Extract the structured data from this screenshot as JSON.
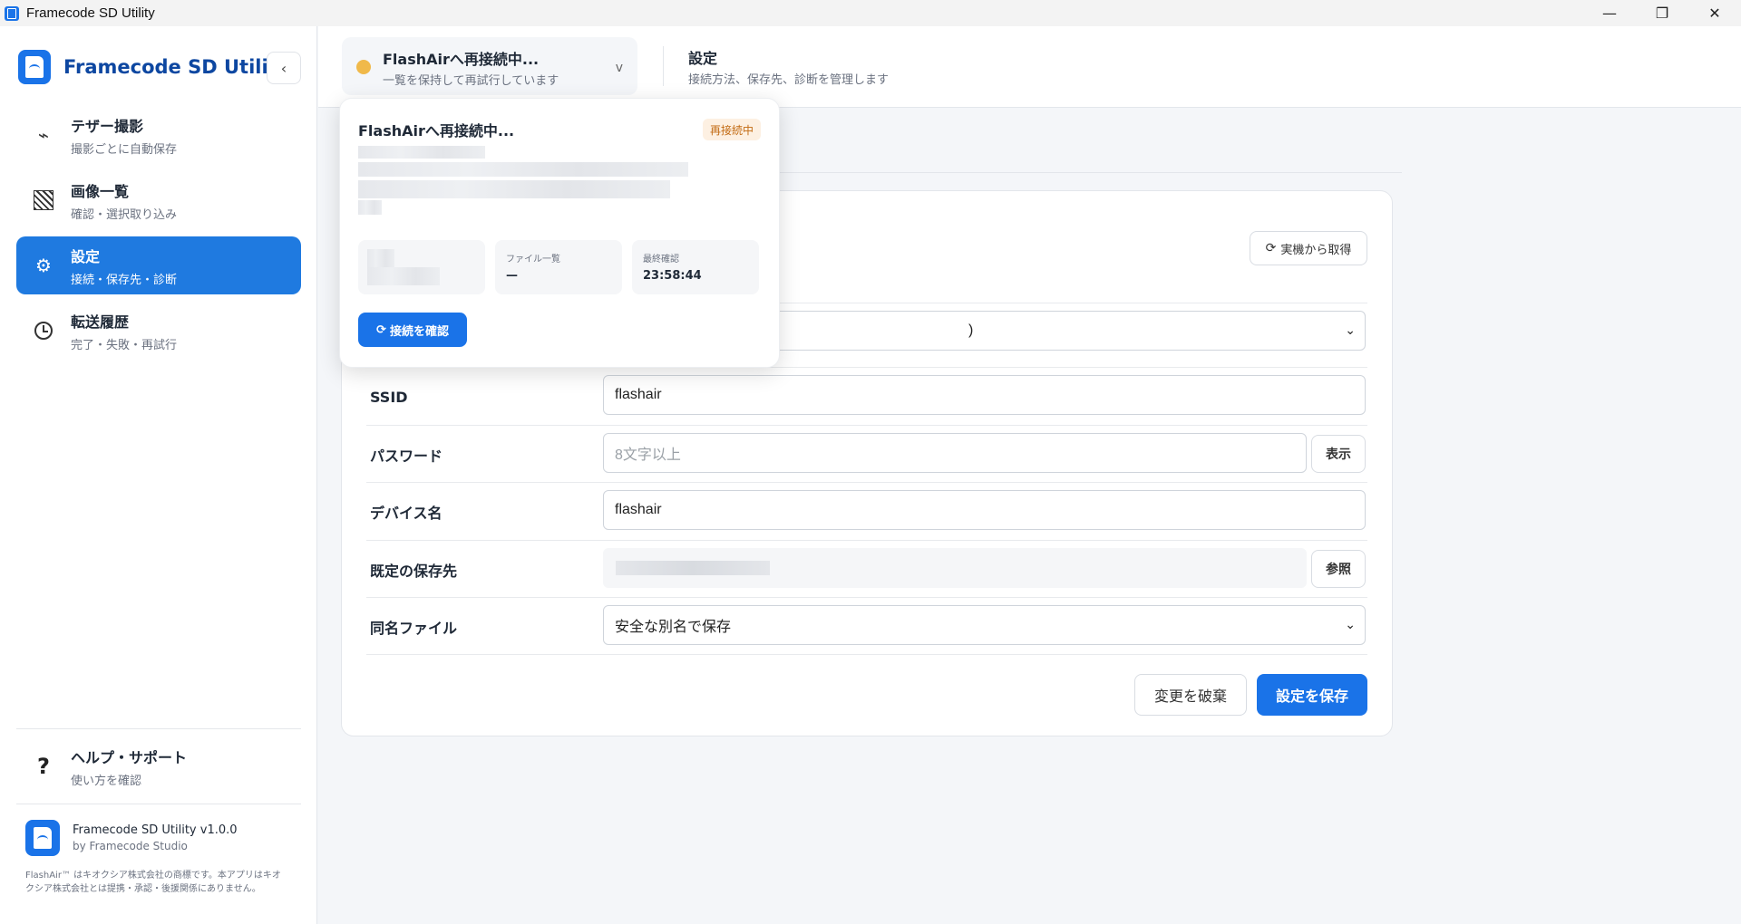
{
  "window": {
    "title": "Framecode SD Utility",
    "minimize": "—",
    "maximize": "❐",
    "close": "✕"
  },
  "sidebar": {
    "brand": "Framecode SD Utility",
    "collapse": "‹",
    "items": [
      {
        "label": "テザー撮影",
        "sub": "撮影ごとに自動保存",
        "icon": "bolt-icon"
      },
      {
        "label": "画像一覧",
        "sub": "確認・選択取り込み",
        "icon": "gallery-icon"
      },
      {
        "label": "設定",
        "sub": "接続・保存先・診断",
        "icon": "gear-icon"
      },
      {
        "label": "転送履歴",
        "sub": "完了・失敗・再試行",
        "icon": "clock-icon"
      }
    ],
    "help": {
      "label": "ヘルプ・サポート",
      "sub": "使い方を確認",
      "icon": "?"
    },
    "footer": {
      "version": "Framecode SD Utility v1.0.0",
      "by": "by Framecode Studio",
      "legal": "FlashAir™ はキオクシア株式会社の商標です。本アプリはキオクシア株式会社とは提携・承認・後援関係にありません。"
    }
  },
  "header": {
    "connection": {
      "title": "FlashAirへ再接続中...",
      "sub": "一覧を保持して再試行しています",
      "chevron": "v"
    },
    "page_title": "設定",
    "page_sub": "接続方法、保存先、診断を管理します"
  },
  "popover": {
    "title": "FlashAirへ再接続中...",
    "badge": "再接続中",
    "stats": [
      {
        "label": "",
        "value": ""
      },
      {
        "label": "ファイル一覧",
        "value": "—"
      },
      {
        "label": "最終確認",
        "value": "23:58:44"
      }
    ],
    "check_button": "接続を確認"
  },
  "settings": {
    "fetch_button": "実機から取得",
    "select_partial": ")",
    "rows": [
      {
        "label": "SSID",
        "value": "flashair"
      },
      {
        "label": "パスワード",
        "placeholder": "8文字以上",
        "button": "表示"
      },
      {
        "label": "デバイス名",
        "value": "flashair"
      },
      {
        "label": "既定の保存先",
        "button": "参照"
      },
      {
        "label": "同名ファイル",
        "value": "安全な別名で保存"
      }
    ],
    "discard_button": "変更を破棄",
    "save_button": "設定を保存"
  },
  "colors": {
    "accent": "#1a73e8",
    "status_reconnecting": "#f0b94a",
    "badge_bg": "#fdf0e2",
    "badge_text": "#c26a12"
  }
}
